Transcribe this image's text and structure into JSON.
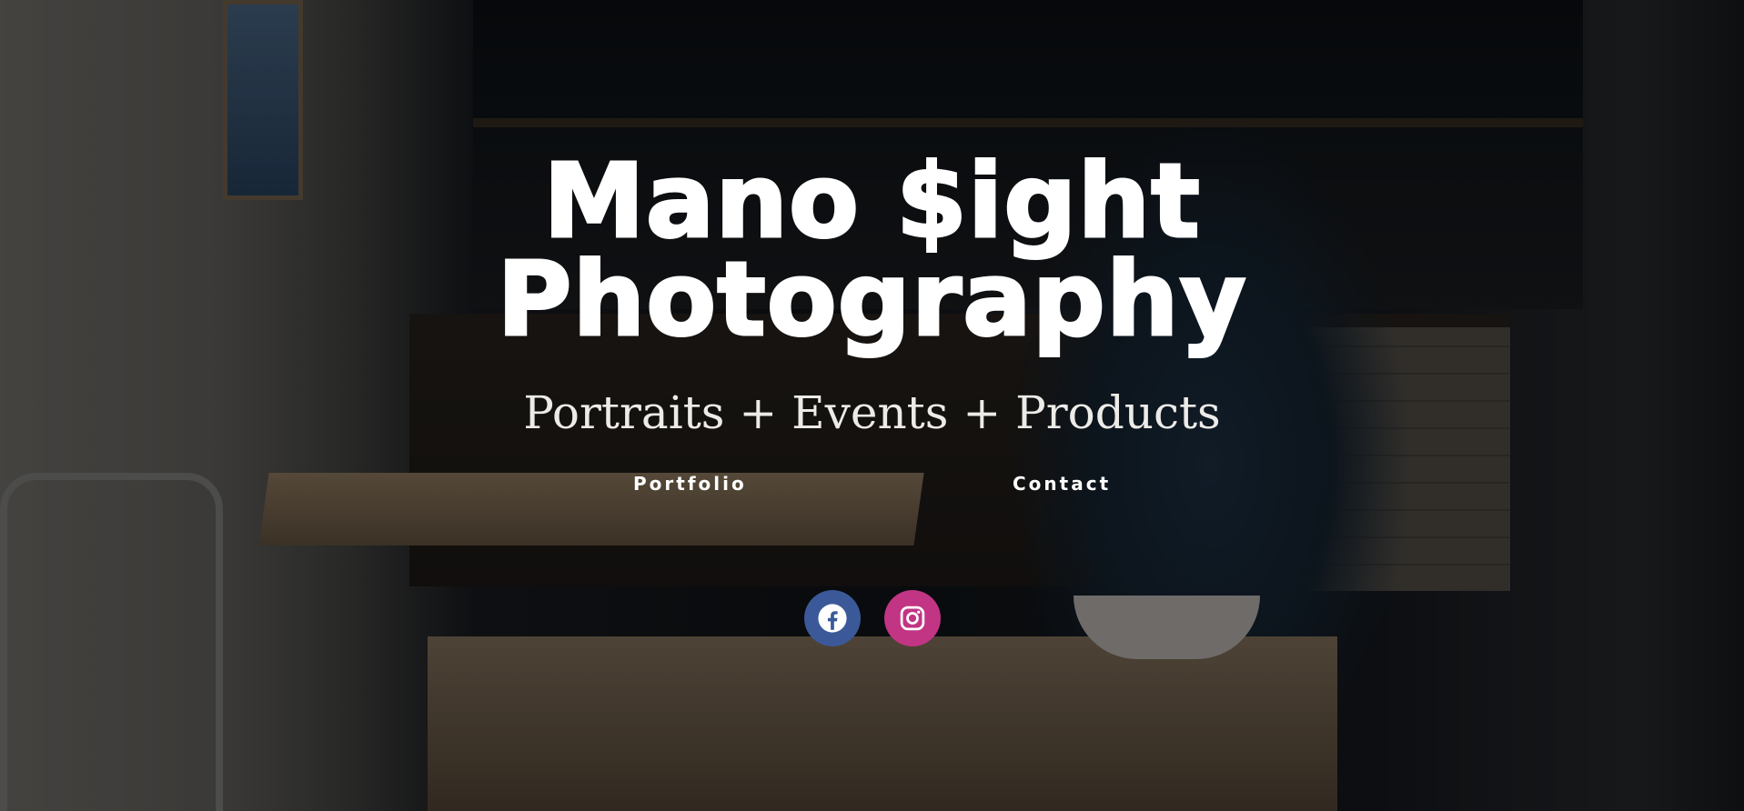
{
  "hero": {
    "title_line1": "Mano $ight",
    "title_line2": "Photography",
    "tagline": "Portraits + Events + Products"
  },
  "nav": {
    "portfolio_label": "Portfolio",
    "contact_label": "Contact"
  },
  "social": [
    {
      "icon": "facebook-icon",
      "color": "#3b5998"
    },
    {
      "icon": "instagram-icon",
      "color": "#c13584"
    }
  ]
}
